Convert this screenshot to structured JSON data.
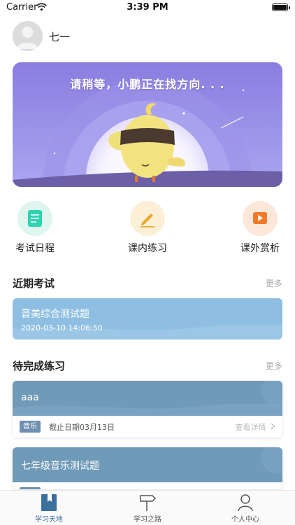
{
  "status_bar": {
    "carrier": "Carrier",
    "time": "3:39 PM"
  },
  "user": {
    "name": "七一"
  },
  "banner": {
    "message": "请稍等，小鹏正在找方向. . ."
  },
  "quick_entries": [
    {
      "label": "考试日程",
      "icon": "document-icon",
      "color": "#2ed3b0"
    },
    {
      "label": "课内练习",
      "icon": "pencil-icon",
      "color": "#e8a92a"
    },
    {
      "label": "课外赏析",
      "icon": "play-icon",
      "color": "#f07a2a"
    }
  ],
  "recent_exams": {
    "title": "近期考试",
    "more": "更多",
    "items": [
      {
        "title": "音美综合测试题",
        "time": "2020-03-10 14:06:50"
      }
    ]
  },
  "pending_practice": {
    "title": "待完成练习",
    "more": "更多",
    "items": [
      {
        "title": "aaa",
        "subject": "音乐",
        "deadline": "截止日期03月13日",
        "detail": "查看详情"
      },
      {
        "title": "七年级音乐测试题"
      }
    ]
  },
  "tab_bar": {
    "active_color": "#3d6f9e",
    "inactive_color": "#555555",
    "tabs": [
      {
        "label": "学习天地",
        "icon": "bookmark-book-icon"
      },
      {
        "label": "学习之路",
        "icon": "signpost-icon"
      },
      {
        "label": "个人中心",
        "icon": "person-icon"
      }
    ]
  }
}
